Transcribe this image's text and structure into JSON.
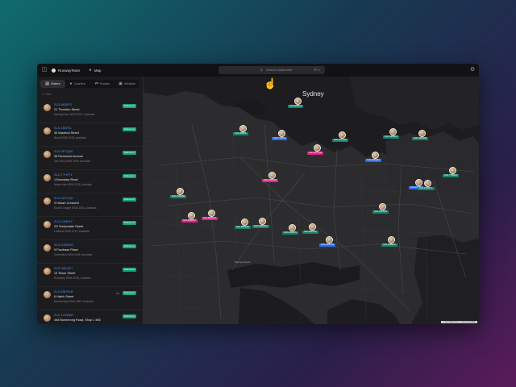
{
  "app": {
    "brand": "RunwayTeam",
    "section": "Map"
  },
  "search": {
    "placeholder": "Search customers",
    "shortcut": "⌘ K"
  },
  "sidebar": {
    "tabs": [
      {
        "label": "Orders",
        "icon": "inbox-icon",
        "glyph": "▤"
      },
      {
        "label": "Couriers",
        "icon": "user-icon",
        "glyph": "●"
      },
      {
        "label": "Routes",
        "icon": "route-icon",
        "glyph": "⇄"
      },
      {
        "label": "Vehicles",
        "icon": "truck-icon",
        "glyph": "▣"
      }
    ],
    "filter_placeholder": "Filter",
    "items": [
      {
        "code": "SLD-6830FS",
        "address": "21 Thornton Street",
        "sub": "Darling Point NSW 2027, Australia",
        "status": "Delivered"
      },
      {
        "code": "SLD-1B5F5L",
        "address": "36 Macleod Street",
        "sub": "Bondi NSW 2026, Australia",
        "status": "Delivered"
      },
      {
        "code": "SLD-3FTQ4B",
        "address": "38 Richmond Avenue",
        "sub": "Dee Why NSW 2099, Australia",
        "status": "Delivered"
      },
      {
        "code": "SLD-T7HFT1",
        "address": "1 Boundary Road",
        "sub": "Mona Vale NSW 2103, Australia",
        "status": "Delivered"
      },
      {
        "code": "SLD-4AYVQD",
        "address": "3 Hobart Crescent",
        "sub": "South Coogee NSW 2034, Australia",
        "status": "Delivered"
      },
      {
        "code": "SLD-C8NBLF",
        "address": "2/2 Roslyndale Street",
        "sub": "Lindfield NSW 2070, Australia",
        "status": "Delivered"
      },
      {
        "code": "SLD-G9SBVR",
        "address": "9 Purchase Place",
        "sub": "Greenwich NSW 2065, Australia",
        "status": "Delivered"
      },
      {
        "code": "SLD-9AEQF1",
        "address": "13 Tilson Street",
        "sub": "Rosebery NSW 2018, Australia",
        "status": "Delivered"
      },
      {
        "code": "SLD-K5DNLB",
        "address": "6 Hatch Street",
        "sub": "Neutral Bay NSW 2089, Australia",
        "status": "Delivered",
        "chat": true
      },
      {
        "code": "SLD-1V3W6R",
        "address": "446 Bunnerong Road, Shop 1 466",
        "sub": "",
        "status": "Delivered"
      }
    ]
  },
  "map": {
    "city": "Sydney",
    "place": "Sydney Airport",
    "attribution": "© OpenMapTiles © OpenStreetMap",
    "markers": [
      {
        "label": "SLD-6830FS",
        "kind": "g"
      },
      {
        "label": "SLD-1B5F5L",
        "kind": "g"
      },
      {
        "label": "SLD-3FTQ4B",
        "kind": "g"
      },
      {
        "label": "SLD-T7HFT1",
        "kind": "b"
      },
      {
        "label": "SLD-4AYVQD",
        "kind": "p"
      },
      {
        "label": "SLD-C8NBLF",
        "kind": "g"
      },
      {
        "label": "SLD-G9SBVR",
        "kind": "g"
      },
      {
        "label": "SLD-9AEQF1",
        "kind": "b"
      },
      {
        "label": "SLD-K5DNLB",
        "kind": "p"
      },
      {
        "label": "SLD-1V3W6R",
        "kind": "g"
      },
      {
        "label": "SLD-7TRW2A",
        "kind": "g"
      },
      {
        "label": "SLD-2XK8PL",
        "kind": "b"
      },
      {
        "label": "SLD-8HNR3T",
        "kind": "p"
      },
      {
        "label": "SLD-5QBW9C",
        "kind": "g"
      },
      {
        "label": "SLD-3ZLM6N",
        "kind": "g"
      },
      {
        "label": "SLD-6DPG1K",
        "kind": "g"
      },
      {
        "label": "SLD-4MTV8S",
        "kind": "b"
      },
      {
        "label": "SLD-9JRE2H",
        "kind": "g"
      },
      {
        "label": "SLD-1CWX7Y",
        "kind": "g"
      },
      {
        "label": "SLD-5NFA4U",
        "kind": "p"
      },
      {
        "label": "SLD-8BKQ3E",
        "kind": "g"
      },
      {
        "label": "SLD-2GLT6W",
        "kind": "g"
      }
    ]
  },
  "colors": {
    "status_delivered": "#1aa178",
    "marker_blue": "#2a6ee8",
    "marker_pink": "#e0208a",
    "link": "#4c8ff0"
  }
}
